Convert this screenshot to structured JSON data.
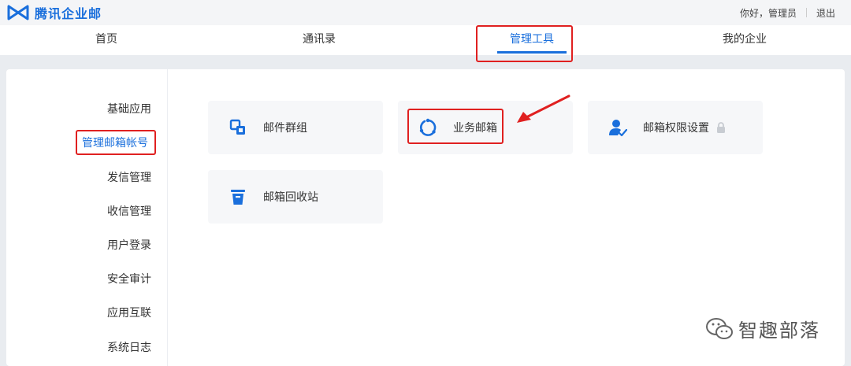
{
  "app": {
    "name": "腾讯企业邮"
  },
  "user": {
    "greeting": "你好，管理员",
    "logout": "退出"
  },
  "nav": [
    {
      "label": "首页"
    },
    {
      "label": "通讯录"
    },
    {
      "label": "管理工具"
    },
    {
      "label": "我的企业"
    }
  ],
  "sidebar": [
    {
      "label": "基础应用"
    },
    {
      "label": "管理邮箱帐号"
    },
    {
      "label": "发信管理"
    },
    {
      "label": "收信管理"
    },
    {
      "label": "用户登录"
    },
    {
      "label": "安全审计"
    },
    {
      "label": "应用互联"
    },
    {
      "label": "系统日志"
    }
  ],
  "cards": [
    {
      "label": "邮件群组",
      "icon": "group-icon"
    },
    {
      "label": "业务邮箱",
      "icon": "business-mailbox-icon"
    },
    {
      "label": "邮箱权限设置",
      "icon": "user-permission-icon"
    },
    {
      "label": "邮箱回收站",
      "icon": "trash-icon"
    }
  ],
  "watermark": {
    "text": "智趣部落"
  },
  "colors": {
    "accent": "#1a6fdc",
    "highlight": "#e02020"
  }
}
